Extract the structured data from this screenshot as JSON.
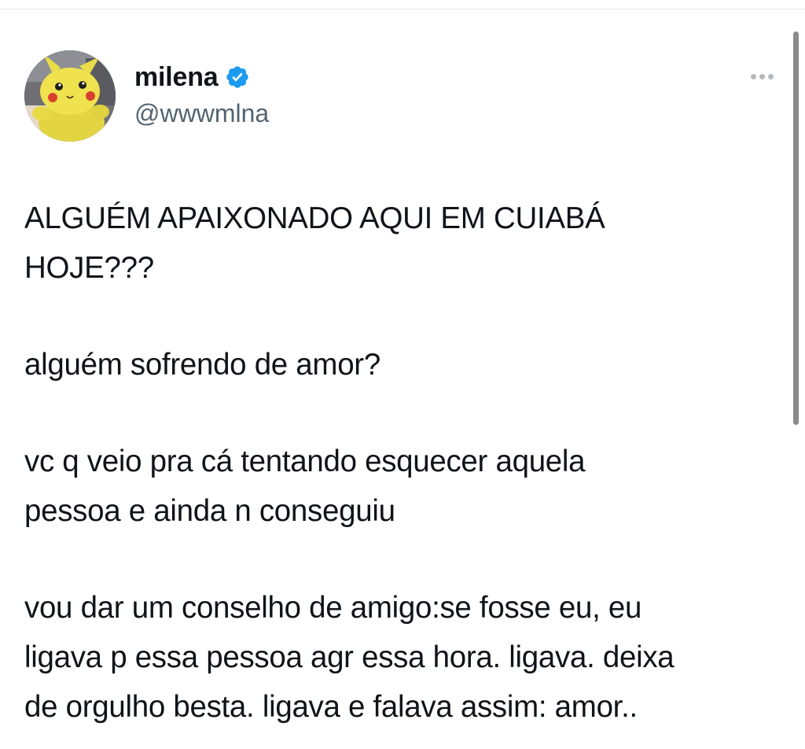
{
  "tweet": {
    "author": {
      "display_name": "milena",
      "handle": "@wwwmlna",
      "verified": true,
      "avatar": "pikachu-plush-avatar",
      "verified_icon": "verified-badge-icon",
      "verified_color": "#1d9bf0"
    },
    "more_icon": "more-horizontal-icon",
    "paragraphs": [
      "ALGUÉM APAIXONADO AQUI EM CUIABÁ\nHOJE???",
      "alguém sofrendo de amor?",
      "vc q veio pra cá tentando esquecer aquela\npessoa e ainda n conseguiu",
      "vou dar um conselho de amigo:se fosse eu, eu\nligava p essa pessoa agr essa hora. ligava. deixa\nde orgulho besta. ligava e falava assim: amor.."
    ]
  },
  "colors": {
    "text_primary": "#0f1419",
    "text_secondary": "#536471",
    "accent": "#1d9bf0",
    "background": "#ffffff"
  }
}
